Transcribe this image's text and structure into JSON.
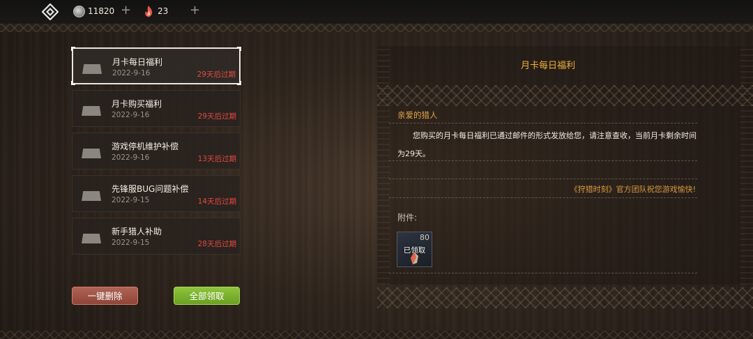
{
  "topbar": {
    "coins": "11820",
    "flames": "23"
  },
  "mails": [
    {
      "title": "月卡每日福利",
      "date": "2022-9-16",
      "expire": "29天后过期",
      "selected": true
    },
    {
      "title": "月卡购买福利",
      "date": "2022-9-16",
      "expire": "29天后过期",
      "selected": false
    },
    {
      "title": "游戏停机维护补偿",
      "date": "2022-9-16",
      "expire": "13天后过期",
      "selected": false
    },
    {
      "title": "先锋服BUG问题补偿",
      "date": "2022-9-15",
      "expire": "14天后过期",
      "selected": false
    },
    {
      "title": "新手猎人补助",
      "date": "2022-9-15",
      "expire": "28天后过期",
      "selected": false
    }
  ],
  "buttons": {
    "delete_all": "一键删除",
    "claim_all": "全部领取"
  },
  "detail": {
    "title": "月卡每日福利",
    "greeting": "亲爱的猎人",
    "body": "您购买的月卡每日福利已通过邮件的形式发放给您，请注意查收，当前月卡剩余时间为29天。",
    "signature": "《狩猎时刻》官方团队祝您游戏愉快!",
    "attachment_label": "附件:",
    "attachment": {
      "count": "80",
      "status": "已领取"
    }
  },
  "colors": {
    "accent_title": "#f0b238",
    "expire_red": "#e24a40",
    "delete_button": "#a0564a",
    "claim_button": "#7fb431"
  }
}
